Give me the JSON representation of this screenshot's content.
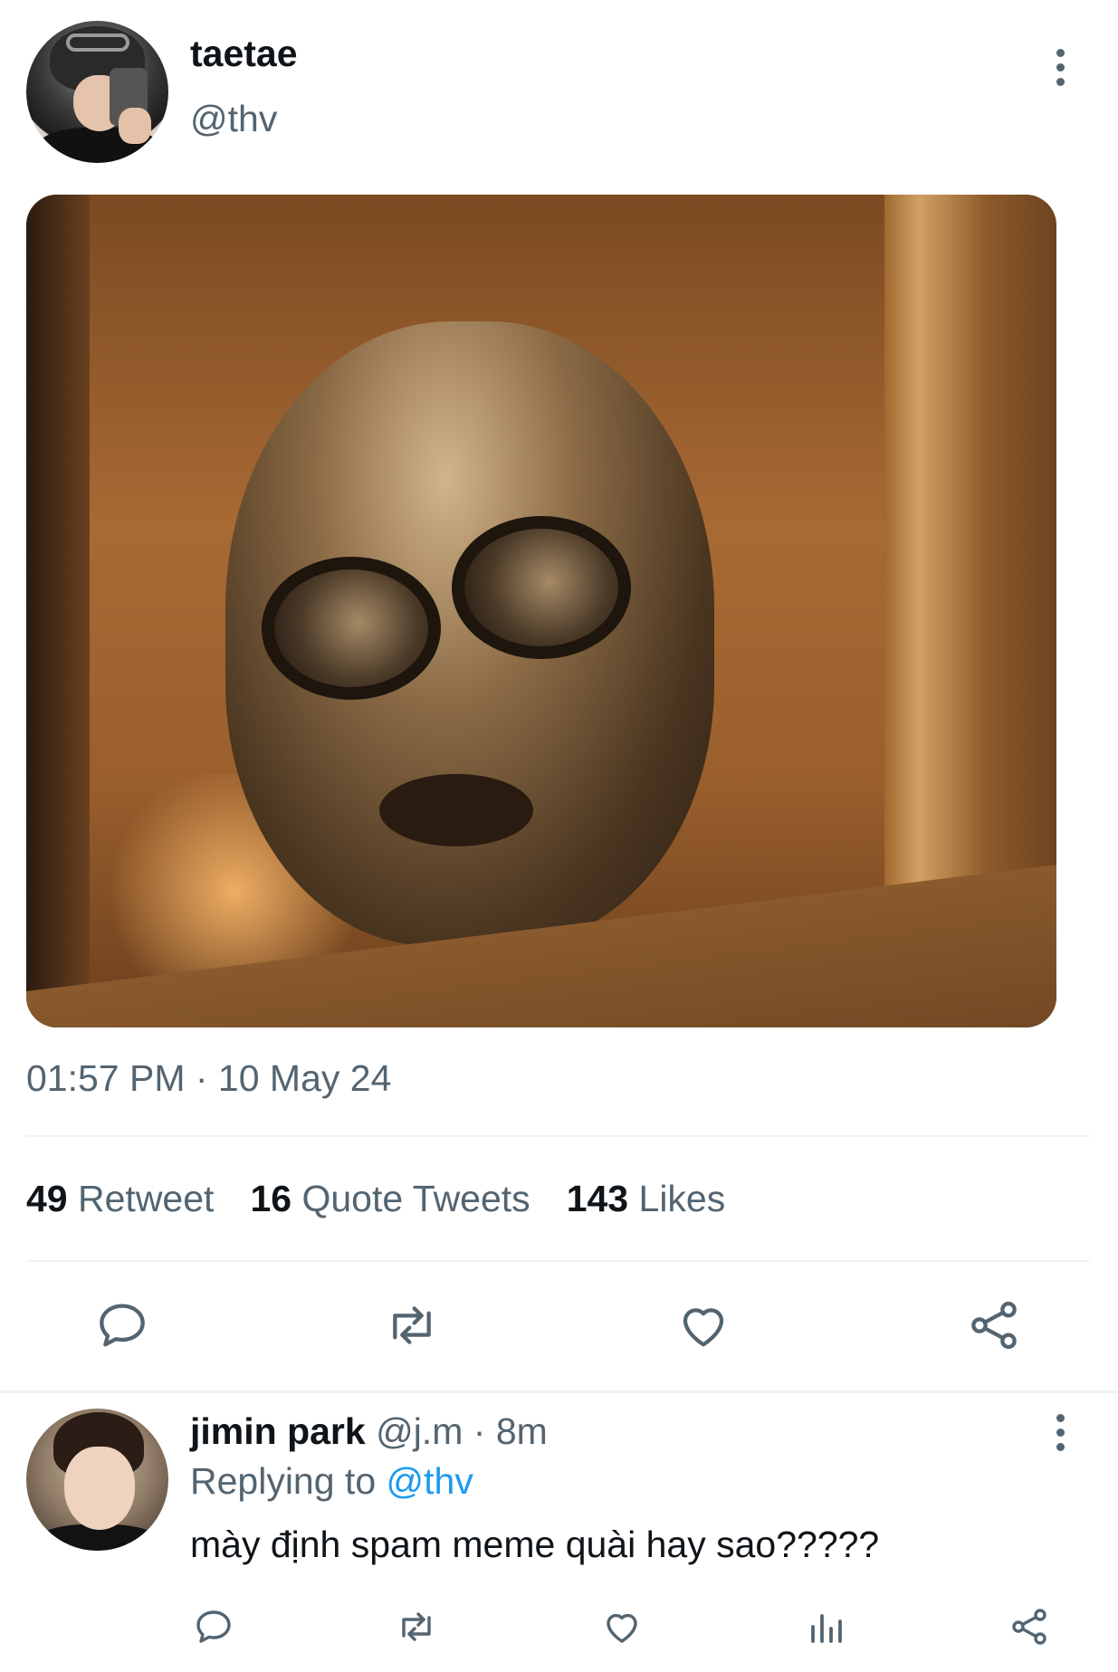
{
  "tweet": {
    "author": {
      "display_name": "taetae",
      "handle": "@thv"
    },
    "media_alt": "meme image",
    "timestamp": "01:57 PM · 10 May 24",
    "stats": [
      {
        "count": "49",
        "label": "Retweet"
      },
      {
        "count": "16",
        "label": "Quote Tweets"
      },
      {
        "count": "143",
        "label": "Likes"
      }
    ],
    "actions": [
      "reply-icon",
      "retweet-icon",
      "like-icon",
      "share-icon"
    ]
  },
  "reply": {
    "author": {
      "display_name": "jimin park",
      "handle": "@j.m",
      "time": "8m",
      "separator": "·"
    },
    "replying_to_prefix": "Replying to ",
    "replying_to_handle": "@thv",
    "text": "mày định spam meme quài hay sao?????",
    "actions": [
      "reply-icon",
      "retweet-icon",
      "like-icon",
      "analytics-icon",
      "share-icon"
    ]
  },
  "colors": {
    "text_primary": "#0f1419",
    "text_secondary": "#536471",
    "link": "#1d9bf0",
    "divider": "#eff3f4"
  }
}
